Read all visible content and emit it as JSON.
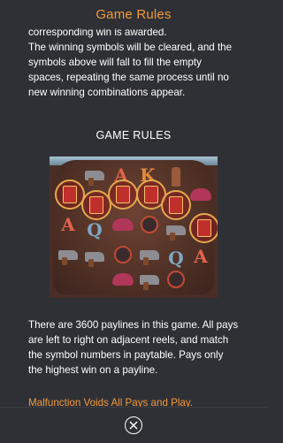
{
  "header": {
    "title": "Game Rules"
  },
  "rules_text": {
    "paragraph_1": "corresponding win is awarded.",
    "paragraph_2": "The winning symbols will be cleared, and the symbols above will fall to fill the empty spaces, repeating the same process until no new winning combinations appear."
  },
  "section": {
    "heading": "GAME RULES"
  },
  "reel_image": {
    "symbols": [
      "A",
      "K",
      "A",
      "Q",
      "A",
      "Q",
      "A"
    ],
    "icon_names": [
      "coin-icon",
      "revolver-icon",
      "hat-icon",
      "bomb-icon",
      "bottle-icon"
    ]
  },
  "paylines_text": "There are 3600 paylines in this game. All pays are left to right on adjacent reels, and match the symbol numbers in paytable. Pays only the highest win on a payline.",
  "malfunction_text": "Malfunction Voids All Pays and Play.",
  "footer": {
    "close_icon": "close-icon"
  },
  "colors": {
    "accent": "#f39a3c",
    "background": "#2f3036",
    "text": "#ffffff"
  }
}
